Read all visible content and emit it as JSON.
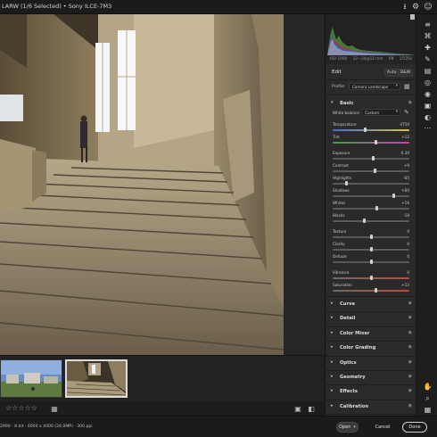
{
  "window": {
    "title": "LARW (1/6 Selected) • Sony ILCE-7M3"
  },
  "titlebar": {
    "icons": [
      "save-icon",
      "settings-icon",
      "user-icon"
    ]
  },
  "histogram": {
    "iso": "ISO 1000",
    "focal": "12—24@12 mm",
    "aperture": "f/8",
    "shutter": "1/125s"
  },
  "edit": {
    "title": "Edit",
    "auto_label": "Auto",
    "bw_label": "B&W"
  },
  "profile": {
    "label": "Profile",
    "value": "Camera Landscape"
  },
  "basic": {
    "title": "Basic",
    "white_balance_label": "White balance",
    "white_balance_value": "Custom",
    "sliders": [
      {
        "name": "Temperature",
        "value": "4750",
        "position": 0.42
      },
      {
        "name": "Tint",
        "value": "+12",
        "position": 0.56
      },
      {
        "name": "Exposure",
        "value": "0.30",
        "position": 0.53
      },
      {
        "name": "Contrast",
        "value": "+9",
        "position": 0.55
      },
      {
        "name": "Highlights",
        "value": "-65",
        "position": 0.18
      },
      {
        "name": "Shadows",
        "value": "+60",
        "position": 0.8
      },
      {
        "name": "Whites",
        "value": "+16",
        "position": 0.58
      },
      {
        "name": "Blacks",
        "value": "-18",
        "position": 0.41
      },
      {
        "name": "Texture",
        "value": "0",
        "position": 0.5
      },
      {
        "name": "Clarity",
        "value": "0",
        "position": 0.5
      },
      {
        "name": "Dehaze",
        "value": "0",
        "position": 0.5
      },
      {
        "name": "Vibrance",
        "value": "0",
        "position": 0.5
      },
      {
        "name": "Saturation",
        "value": "+12",
        "position": 0.56
      }
    ]
  },
  "sections": [
    "Curve",
    "Detail",
    "Color Mixer",
    "Color Grading",
    "Optics",
    "Geometry",
    "Effects",
    "Calibration"
  ],
  "filmstrip": {
    "rating_stars": "☆☆☆☆☆"
  },
  "status": {
    "text": "2990 · 8 bit · 6000 x 4000 (24.0MP) · 300 ppi",
    "open_label": "Open",
    "cancel_label": "Cancel",
    "done_label": "Done"
  },
  "colors": {
    "accent": "#1473e6",
    "panel": "#2a2a2a",
    "background": "#1e1e1e"
  }
}
